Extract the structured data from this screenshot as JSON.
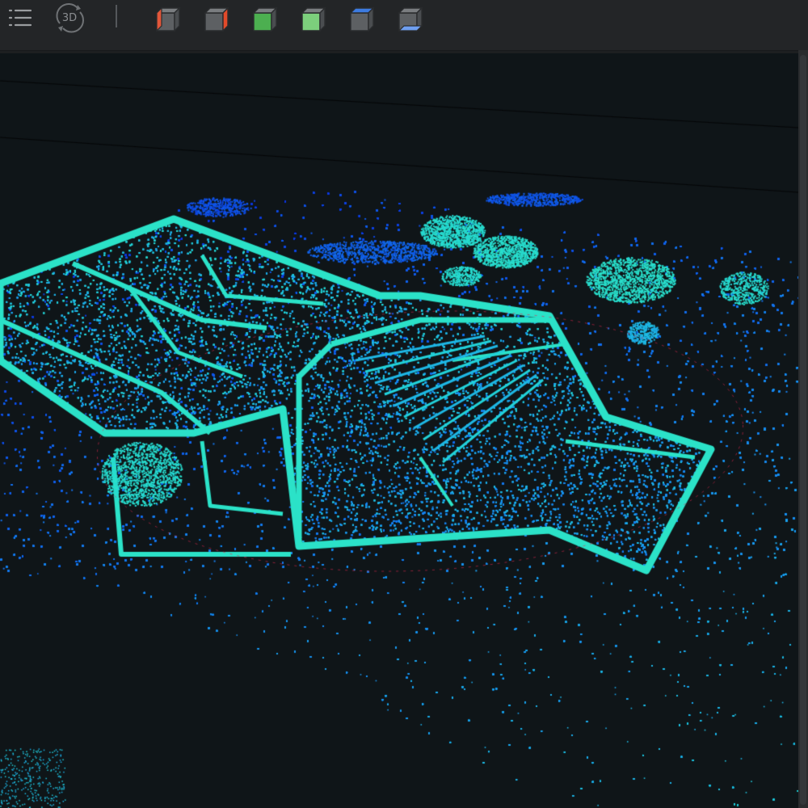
{
  "toolbar": {
    "list_icon": "list-tree-icon",
    "view_mode_label": "3D",
    "view_cubes": [
      {
        "name": "left-view-cube-icon",
        "face": "left",
        "color": "#e2563a"
      },
      {
        "name": "right-view-cube-icon",
        "face": "right",
        "color": "#e24a2a"
      },
      {
        "name": "front-view-cube-icon",
        "face": "front",
        "color": "#4caf50"
      },
      {
        "name": "back-view-cube-icon",
        "face": "back",
        "color": "#7ccf7c"
      },
      {
        "name": "top-view-cube-icon",
        "face": "top",
        "color": "#3d7be0"
      },
      {
        "name": "bottom-view-cube-icon",
        "face": "bottom",
        "color": "#6f9ff0"
      }
    ]
  },
  "viewport": {
    "background": "#0f1518",
    "colormap": [
      "#0a22d8",
      "#1061ec",
      "#1a9df0",
      "#22d4d8",
      "#2fe8c0"
    ]
  }
}
